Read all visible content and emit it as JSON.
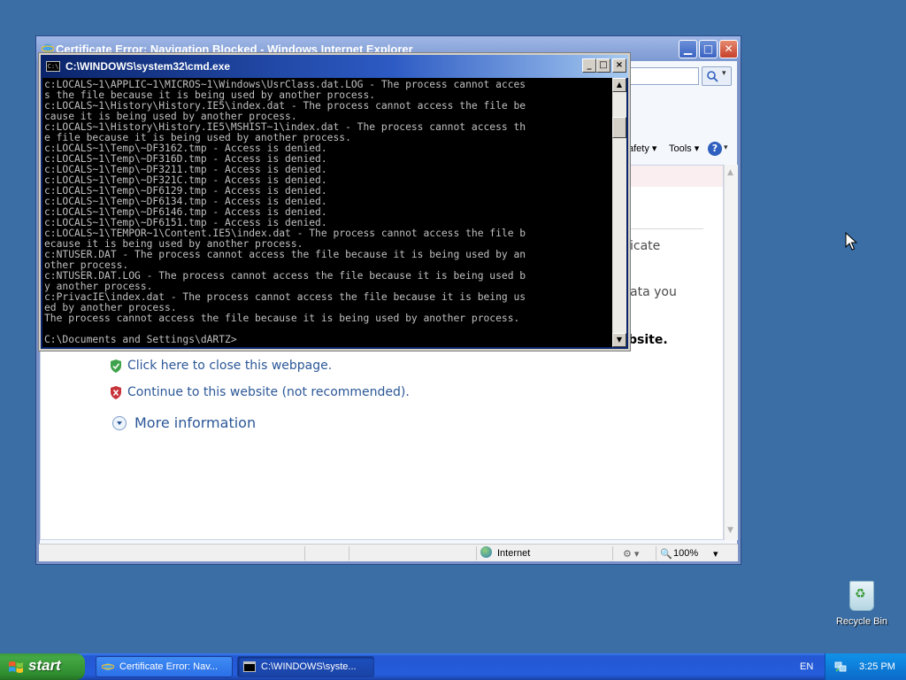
{
  "ie_window": {
    "title": "Certificate Error: Navigation Blocked - Windows Internet Explorer",
    "toolbar": {
      "safety_label": "afety ▾",
      "tools_label": "Tools ▾",
      "help_label": "?"
    },
    "content": {
      "partial_1": "icate",
      "partial_2": "ata you",
      "partial_3": "bsite.",
      "close_link": "Click here to close this webpage.",
      "continue_link": "Continue to this website (not recommended).",
      "more_info": "More information"
    },
    "status": {
      "zone": "Internet",
      "zoom": "100%"
    }
  },
  "cmd_window": {
    "title": "C:\\WINDOWS\\system32\\cmd.exe",
    "icon_text": "C:\\",
    "lines": [
      "c:LOCALS~1\\APPLIC~1\\MICROS~1\\Windows\\UsrClass.dat.LOG - The process cannot acces",
      "s the file because it is being used by another process.",
      "c:LOCALS~1\\History\\History.IE5\\index.dat - The process cannot access the file be",
      "cause it is being used by another process.",
      "c:LOCALS~1\\History\\History.IE5\\MSHIST~1\\index.dat - The process cannot access th",
      "e file because it is being used by another process.",
      "c:LOCALS~1\\Temp\\~DF3162.tmp - Access is denied.",
      "c:LOCALS~1\\Temp\\~DF316D.tmp - Access is denied.",
      "c:LOCALS~1\\Temp\\~DF3211.tmp - Access is denied.",
      "c:LOCALS~1\\Temp\\~DF321C.tmp - Access is denied.",
      "c:LOCALS~1\\Temp\\~DF6129.tmp - Access is denied.",
      "c:LOCALS~1\\Temp\\~DF6134.tmp - Access is denied.",
      "c:LOCALS~1\\Temp\\~DF6146.tmp - Access is denied.",
      "c:LOCALS~1\\Temp\\~DF6151.tmp - Access is denied.",
      "c:LOCALS~1\\TEMPOR~1\\Content.IE5\\index.dat - The process cannot access the file b",
      "ecause it is being used by another process.",
      "c:NTUSER.DAT - The process cannot access the file because it is being used by an",
      "other process.",
      "c:NTUSER.DAT.LOG - The process cannot access the file because it is being used b",
      "y another process.",
      "c:PrivacIE\\index.dat - The process cannot access the file because it is being us",
      "ed by another process.",
      "The process cannot access the file because it is being used by another process.",
      "",
      "C:\\Documents and Settings\\dARTZ>"
    ]
  },
  "desktop": {
    "recycle_bin_label": "Recycle Bin"
  },
  "taskbar": {
    "start_label": "start",
    "tasks": [
      {
        "label": "Certificate Error: Nav..."
      },
      {
        "label": "C:\\WINDOWS\\syste..."
      }
    ],
    "language": "EN",
    "clock": "3:25 PM"
  }
}
